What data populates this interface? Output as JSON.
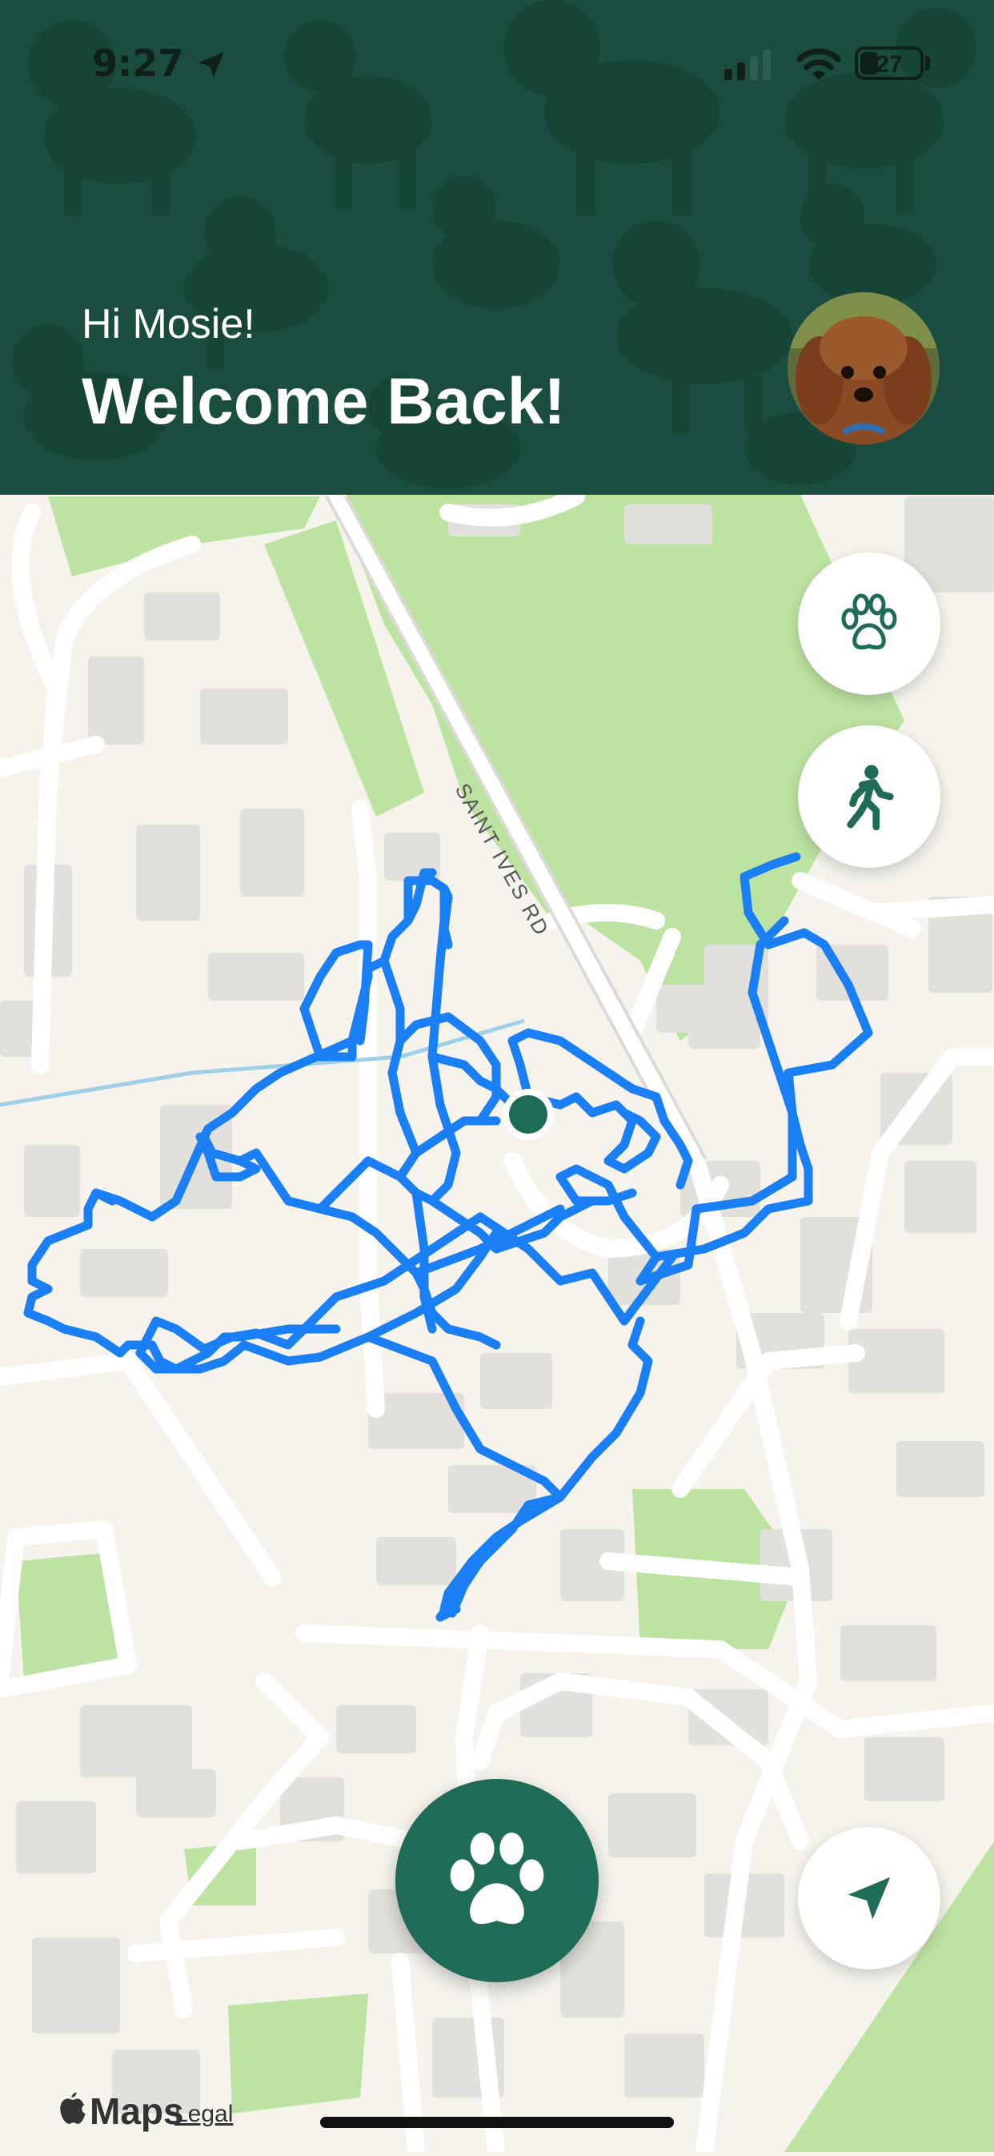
{
  "status_bar": {
    "time": "9:27",
    "battery": "27"
  },
  "header": {
    "greeting": "Hi Mosie!",
    "title": "Welcome Back!"
  },
  "map": {
    "street_label": "SAINT IVES RD"
  },
  "footer": {
    "maps_brand": "Maps",
    "legal": "Legal"
  },
  "colors": {
    "header_bg": "#1a4d40",
    "accent": "#1e6b57",
    "route": "#1a7ff5"
  },
  "icons": [
    "paw-icon",
    "walking-icon",
    "navigation-arrow-icon"
  ]
}
